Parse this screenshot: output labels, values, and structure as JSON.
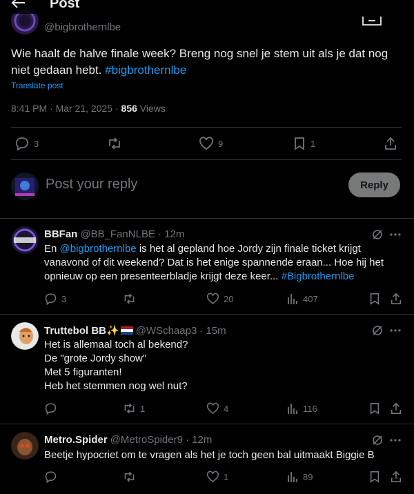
{
  "header": {
    "title": "Post",
    "back_icon": "arrow-left-icon",
    "grok_icon": "grok-icon"
  },
  "post": {
    "handle": "@bigbrothernlbe",
    "text": "Wie haalt de halve finale week? Breng nog snel je stem uit als je dat nog niet gedaan hebt.",
    "hashtag": "#bigbrothernlbe",
    "translate_label": "Translate post",
    "timestamp": "8:41 PM · Mar 21, 2025 · ",
    "views_count": "856",
    "views_label": " Views",
    "actions": {
      "replies": "3",
      "retweets": "",
      "likes": "9",
      "bookmarks": "1"
    }
  },
  "reply_box": {
    "placeholder": "Post your reply",
    "button_label": "Reply"
  },
  "comments": [
    {
      "name": "BBFan",
      "handle": "@BB_FanNLBE",
      "time": "· 12m",
      "text_pre": "En ",
      "mention": "@bigbrothernlbe",
      "text_post": " is het al gepland hoe Jordy zijn finale ticket krijgt vanavond of dit weekend? Dat is het enige spannende eraan... Hoe hij het opnieuw op een presenteerbladje krijgt deze keer... ",
      "hashtag": "#Bigbrothernlbe",
      "replies": "3",
      "retweets": "",
      "likes": "20",
      "views": "407"
    },
    {
      "name": "Truttebol BB",
      "name_emoji": "✨",
      "handle": "@WSchaap3",
      "time": "· 15m",
      "lines": [
        "Het is allemaal toch al bekend?",
        "De \"grote Jordy show\"",
        "Met 5 figuranten!",
        "Heb het stemmen nog wel nut?"
      ],
      "replies": "",
      "retweets": "1",
      "likes": "4",
      "views": "116"
    },
    {
      "name": "Metro.Spider",
      "handle": "@MetroSpider9",
      "time": "· 12m",
      "text": "Beetje hypocriet om te vragen als het je toch geen bal uitmaakt Biggie B",
      "replies": "",
      "retweets": "",
      "likes": "1",
      "views": "89"
    }
  ],
  "colors": {
    "background": "#000000",
    "text": "#e7e9ea",
    "muted": "#71767b",
    "link": "#1d9bf0",
    "divider": "#2f3336",
    "reply_button": "#787a7a"
  }
}
